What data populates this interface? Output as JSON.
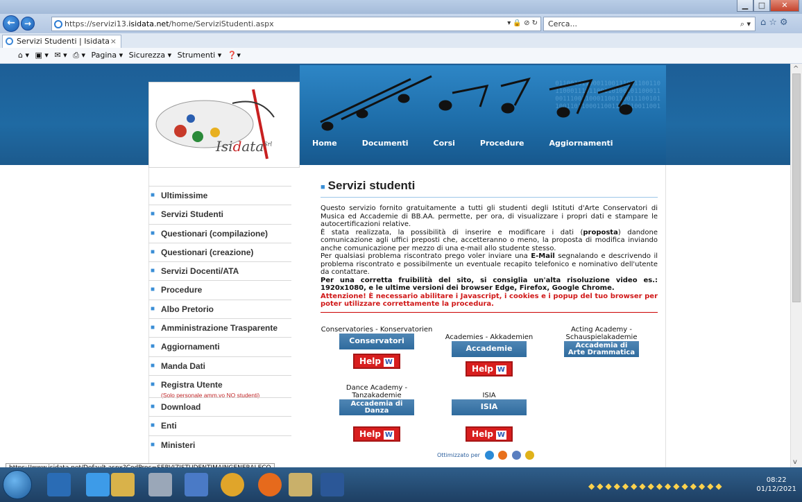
{
  "browser": {
    "url_prefix": "https://servizi13.",
    "url_host": "isidata.net",
    "url_path": "/home/ServiziStudenti.aspx",
    "search_placeholder": "Cerca...",
    "tab_title": "Servizi Studenti | Isidata",
    "commands": [
      "Pagina ▾",
      "Sicurezza ▾",
      "Strumenti ▾"
    ],
    "status_url": "https://www.isidata.net/Default.aspx?CodProc=SERVIZISTUDENTIMAINGENERALECO"
  },
  "header": {
    "nav": [
      "Home",
      "Documenti",
      "Corsi",
      "Procedure",
      "Aggiornamenti"
    ],
    "logo_prefix": "Isi",
    "logo_mid": "d",
    "logo_suffix": "ata"
  },
  "sidebar": {
    "items": [
      "Ultimissime",
      "Servizi Studenti",
      "Questionari (compilazione)",
      "Questionari (creazione)",
      "Servizi Docenti/ATA",
      "Procedure",
      "Albo Pretorio",
      "Amministrazione Trasparente",
      "Aggiornamenti",
      "Manda Dati"
    ],
    "registra": "Registra Utente",
    "registra_note": "(Solo personale amm.vo NO studenti)",
    "items2": [
      "Download",
      "Enti",
      "Ministeri"
    ]
  },
  "main": {
    "title": "Servizi studenti",
    "p1": "Questo servizio fornito gratuitamente a tutti gli studenti degli Istituti d'Arte Conservatori di Musica ed Accademie di BB.AA. permette, per ora, di visualizzare i propri dati e stampare le autocertificazioni relative.",
    "p2a": "È stata realizzata, la possibilità di inserire e modificare i dati (",
    "p2b": "proposta",
    "p2c": ") dandone comunicazione agli uffici preposti che, accetteranno o meno, la proposta di modifica inviando anche comunicazione per mezzo di una e-mail allo studente stesso.",
    "p3a": "Per qualsiasi problema riscontrato prego voler inviare una ",
    "p3b": "E-Mail",
    "p3c": " segnalando e descrivendo il problema riscontrato e possibilmente un eventuale recapito telefonico e nominativo dell'utente da contattare.",
    "p4": "Per una corretta fruibilità del sito, si consiglia un'alta risoluzione video es.: 1920x1080, e le ultime versioni dei browser Edge, Firefox, Google Chrome.",
    "p5": "Attenzione! È necessario abilitare i Javascript, i cookies e i popup del tuo browser per poter utilizzare correttamente la procedura."
  },
  "services": {
    "c1_caption": "Conservatories - Konservatorien",
    "c1_banner": "Conservatori",
    "c2_caption": "Academies - Akkademien",
    "c2_banner": "Accademie",
    "c3_caption": "Acting Academy - Schauspielakademie",
    "c3_banner1": "Accademia di",
    "c3_banner2": "Arte Drammatica",
    "c4_caption": "Dance Academy - Tanzakademie",
    "c4_banner1": "Accademia di",
    "c4_banner2": "Danza",
    "c5_caption": "ISIA",
    "c5_banner": "ISIA",
    "help": "Help",
    "optimized": "Ottimizzato per"
  },
  "taskbar": {
    "time": "08:22",
    "date": "01/12/2021"
  }
}
